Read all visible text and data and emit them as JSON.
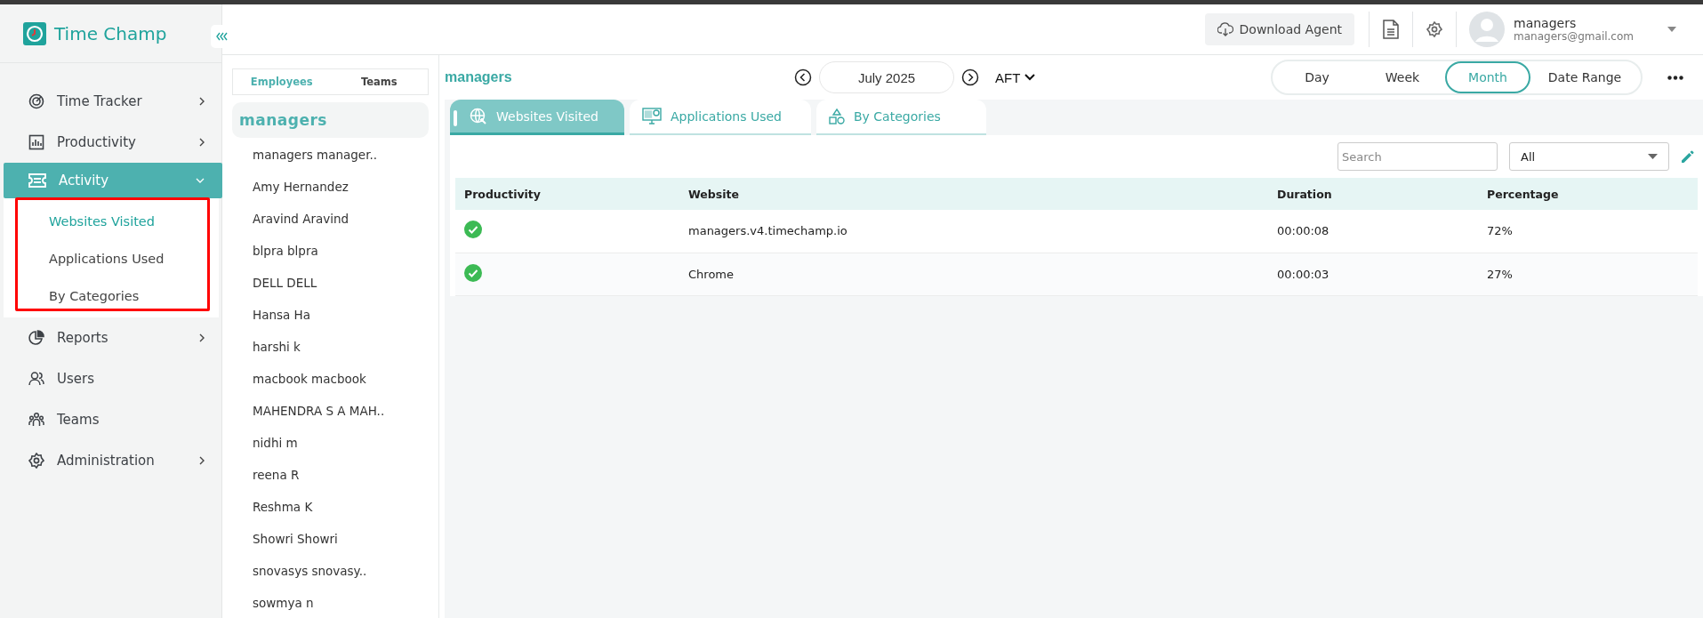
{
  "app": {
    "logo_text": "Time Champ"
  },
  "sidebar": {
    "items": [
      {
        "label": "Time Tracker",
        "expanded": false,
        "selected": false
      },
      {
        "label": "Productivity",
        "expanded": false,
        "selected": false
      },
      {
        "label": "Activity",
        "expanded": true,
        "selected": true,
        "children": [
          {
            "label": "Websites Visited",
            "selected": true
          },
          {
            "label": "Applications Used",
            "selected": false
          },
          {
            "label": "By Categories",
            "selected": false
          }
        ]
      },
      {
        "label": "Reports",
        "expanded": false,
        "selected": false
      },
      {
        "label": "Users",
        "selected": false
      },
      {
        "label": "Teams",
        "selected": false
      },
      {
        "label": "Administration",
        "expanded": false,
        "selected": false
      }
    ]
  },
  "header": {
    "download_button": "Download Agent",
    "user": {
      "name": "managers",
      "email": "managers@gmail.com"
    }
  },
  "people_panel": {
    "tabs": [
      {
        "label": "Employees",
        "selected": true
      },
      {
        "label": "Teams",
        "selected": false
      }
    ],
    "group": "managers",
    "members": [
      "managers manager..",
      "Amy Hernandez",
      "Aravind Aravind",
      "blpra blpra",
      "DELL DELL",
      "Hansa Ha",
      "harshi k",
      "macbook macbook",
      "MAHENDRA S A MAH..",
      "nidhi m",
      "reena R",
      "Reshma K",
      "Showri Showri",
      "snovasys snovasy..",
      "sowmya n"
    ]
  },
  "main": {
    "title": "managers",
    "month": "July 2025",
    "timezone": "AFT",
    "periods": [
      {
        "label": "Day",
        "selected": false
      },
      {
        "label": "Week",
        "selected": false
      },
      {
        "label": "Month",
        "selected": true
      },
      {
        "label": "Date Range",
        "selected": false
      }
    ],
    "tabs": [
      {
        "label": "Websites Visited",
        "selected": true
      },
      {
        "label": "Applications Used",
        "selected": false
      },
      {
        "label": "By Categories",
        "selected": false
      }
    ],
    "search": {
      "placeholder": "Search"
    },
    "filter": {
      "value": "All"
    },
    "table": {
      "columns": [
        "Productivity",
        "Website",
        "Duration",
        "Percentage"
      ],
      "rows": [
        {
          "productive": true,
          "website": "managers.v4.timechamp.io",
          "duration": "00:00:08",
          "percentage": "72%"
        },
        {
          "productive": true,
          "website": "Chrome",
          "duration": "00:00:03",
          "percentage": "27%"
        }
      ]
    }
  }
}
